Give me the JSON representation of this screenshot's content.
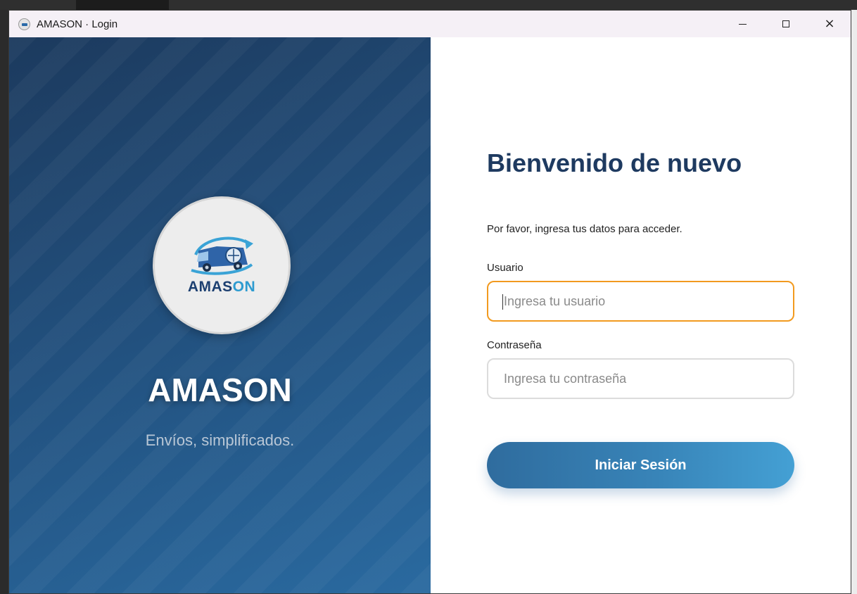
{
  "window": {
    "title": "AMASON · Login",
    "controls": {
      "minimize": "minimize",
      "maximize": "maximize",
      "close": "×"
    }
  },
  "left": {
    "logo_text_main": "AMAS",
    "logo_text_accent": "ON",
    "brand": "AMASON",
    "tagline": "Envíos, simplificados."
  },
  "form": {
    "heading": "Bienvenido de nuevo",
    "subtitle": "Por favor, ingresa tus datos para acceder.",
    "user_label": "Usuario",
    "user_placeholder": "Ingresa tu usuario",
    "user_value": "",
    "pass_label": "Contraseña",
    "pass_placeholder": "Ingresa tu contraseña",
    "pass_value": "",
    "submit_label": "Iniciar Sesión"
  },
  "colors": {
    "accent_focus": "#f29a1f",
    "heading": "#1e3a60",
    "panel_dark": "#1c3a5e",
    "button": "#3884b8"
  },
  "icons": {
    "app": "amason-app-icon",
    "logo": "delivery-van-globe-icon"
  }
}
